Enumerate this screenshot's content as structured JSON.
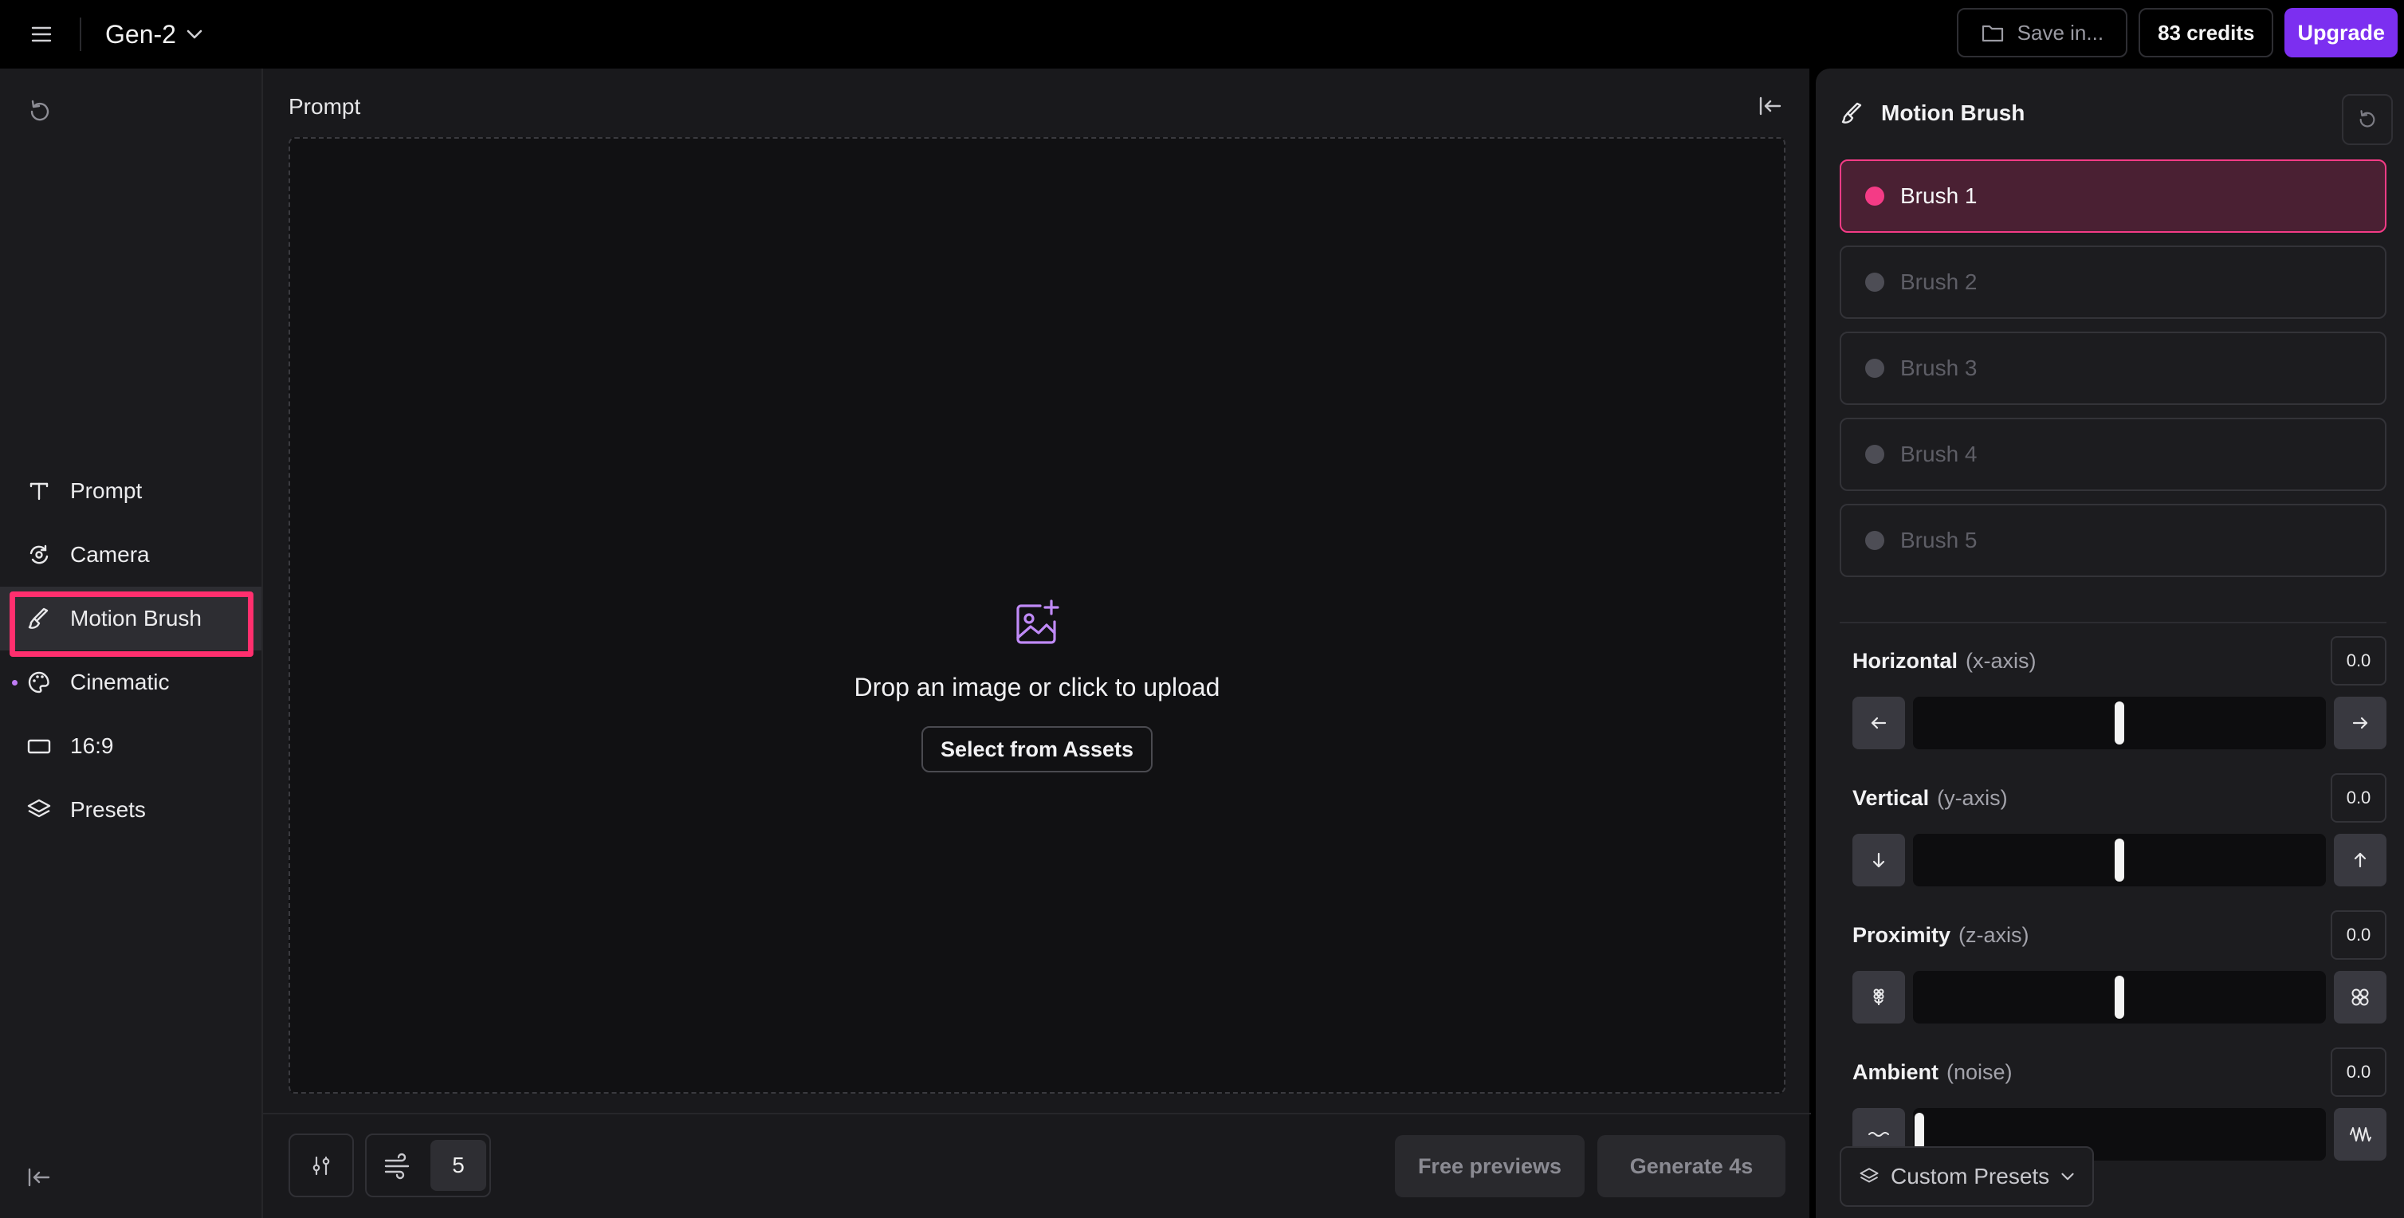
{
  "topbar": {
    "model_label": "Gen-2",
    "save_label": "Save in...",
    "credits_label": "83 credits",
    "upgrade_label": "Upgrade",
    "icons": {
      "menu": "hamburger-icon",
      "model_dropdown": "chevron-down-icon",
      "save": "folder-icon"
    }
  },
  "sidebar": {
    "items": [
      {
        "label": "Prompt",
        "icon": "text-icon",
        "active": false
      },
      {
        "label": "Camera",
        "icon": "camera-motion-icon",
        "active": false
      },
      {
        "label": "Motion Brush",
        "icon": "brush-icon",
        "active": true
      },
      {
        "label": "Cinematic",
        "icon": "palette-icon",
        "active": false,
        "has_dot": true
      },
      {
        "label": "16:9",
        "icon": "aspect-ratio-icon",
        "active": false
      },
      {
        "label": "Presets",
        "icon": "layers-icon",
        "active": false
      }
    ],
    "highlight_color": "#ff2f6e"
  },
  "main": {
    "title": "Prompt",
    "dropzone": {
      "text": "Drop an image or click to upload",
      "assets_button": "Select from Assets",
      "icon": "image-add-icon"
    },
    "bottom": {
      "seed_value": "5",
      "free_previews_label": "Free previews",
      "generate_label": "Generate 4s"
    }
  },
  "motion_brush": {
    "title": "Motion Brush",
    "brushes": [
      {
        "label": "Brush 1",
        "active": true
      },
      {
        "label": "Brush 2",
        "active": false
      },
      {
        "label": "Brush 3",
        "active": false
      },
      {
        "label": "Brush 4",
        "active": false
      },
      {
        "label": "Brush 5",
        "active": false
      }
    ],
    "active_color": "#f43b86",
    "axes": [
      {
        "name": "Horizontal",
        "sub": "(x-axis)",
        "value": "0.0",
        "slider_percent": 50
      },
      {
        "name": "Vertical",
        "sub": "(y-axis)",
        "value": "0.0",
        "slider_percent": 50
      },
      {
        "name": "Proximity",
        "sub": "(z-axis)",
        "value": "0.0",
        "slider_percent": 50
      },
      {
        "name": "Ambient",
        "sub": "(noise)",
        "value": "0.0",
        "slider_percent": 0
      }
    ],
    "custom_presets_label": "Custom Presets"
  },
  "colors": {
    "accent_purple": "#7c2ff0",
    "accent_pink": "#f43b86"
  }
}
